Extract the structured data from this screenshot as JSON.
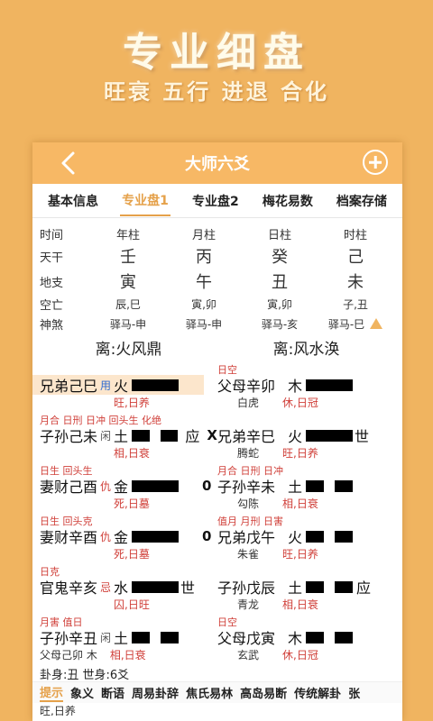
{
  "hero": {
    "title": "专业细盘",
    "subtitle": "旺衰 五行 进退 合化"
  },
  "nav": {
    "title": "大师六爻"
  },
  "tabs": [
    "基本信息",
    "专业盘1",
    "专业盘2",
    "梅花易数",
    "档案存储"
  ],
  "pillars": {
    "header": [
      "时间",
      "年柱",
      "月柱",
      "日柱",
      "时柱"
    ],
    "tiangan": [
      "天干",
      "壬",
      "丙",
      "癸",
      "己"
    ],
    "dizhi": [
      "地支",
      "寅",
      "午",
      "丑",
      "未"
    ],
    "kongwang": [
      "空亡",
      "辰,巳",
      "寅,卯",
      "寅,卯",
      "子,丑"
    ],
    "shensha": [
      "神煞",
      "驿马-申",
      "驿马-申",
      "驿马-亥",
      "驿马-巳"
    ]
  },
  "gua": {
    "main": "离:火风鼎",
    "changed": "离:风水涣"
  },
  "yaos": [
    {
      "left": {
        "tag": "",
        "name": "兄弟己巳",
        "mark": "用",
        "elem": "火",
        "sub": "旺,日养",
        "suffix": ""
      },
      "right": {
        "tag": "日空",
        "name": "父母辛卯",
        "elem": "木",
        "god": "白虎",
        "sub": "休,日冠",
        "suffix": ""
      }
    },
    {
      "left": {
        "tag": "月合 日刑 日冲 回头生 化绝",
        "name": "子孙己未",
        "mark": "闲",
        "elem": "土",
        "sub": "相,日衰",
        "suffix": "应",
        "x": "X"
      },
      "right": {
        "tag": "",
        "name": "兄弟辛巳",
        "elem": "火",
        "god": "腾蛇",
        "sub": "旺,日养",
        "suffix": "世"
      }
    },
    {
      "left": {
        "tag": "日生 回头生",
        "name": "妻财己酉",
        "mark": "仇",
        "elem": "金",
        "sub": "死,日墓",
        "suffix": "",
        "x": "0"
      },
      "right": {
        "tag": "月合 日刑 日冲",
        "name": "子孙辛未",
        "elem": "土",
        "god": "勾陈",
        "sub": "相,日衰",
        "suffix": ""
      }
    },
    {
      "left": {
        "tag": "日生 回头克",
        "name": "妻财辛酉",
        "mark": "仇",
        "elem": "金",
        "sub": "死,日墓",
        "suffix": "",
        "x": "0"
      },
      "right": {
        "tag": "值月 月刑 日害",
        "name": "兄弟戊午",
        "elem": "火",
        "god": "朱雀",
        "sub": "旺,日养",
        "suffix": ""
      }
    },
    {
      "left": {
        "tag": "日克",
        "name": "官鬼辛亥",
        "mark": "忌",
        "elem": "水",
        "sub": "囚,日旺",
        "suffix": "世"
      },
      "right": {
        "tag": "",
        "name": "子孙戊辰",
        "elem": "土",
        "god": "青龙",
        "sub": "相,日衰",
        "suffix": "应"
      }
    },
    {
      "left": {
        "tag": "月害 值日",
        "name": "子孙辛丑",
        "mark": "闲",
        "elem": "土",
        "sub": "相,日衰",
        "suffix": "",
        "fu": "父母己卯 木"
      },
      "right": {
        "tag": "日空",
        "name": "父母戊寅",
        "elem": "木",
        "god": "玄武",
        "sub": "休,日冠",
        "suffix": ""
      }
    }
  ],
  "footer": {
    "line": "卦身:丑 世身:6爻",
    "tail": "旺,日养"
  },
  "bottomTabs": [
    "提示",
    "象义",
    "断语",
    "周易卦辞",
    "焦氏易林",
    "高岛易断",
    "传统解卦",
    "张"
  ],
  "colors": {
    "accent": "#f7b865",
    "background": "#f0b460",
    "tag": "#d0403a",
    "active": "#e5a14a"
  }
}
